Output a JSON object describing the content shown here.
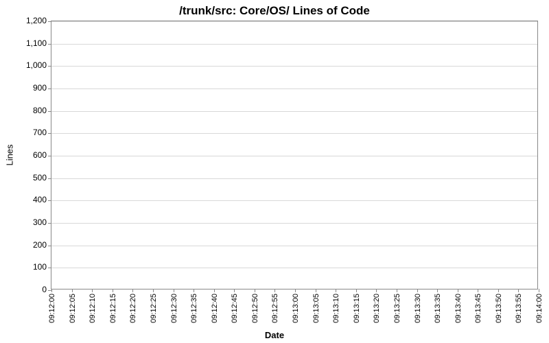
{
  "chart_data": {
    "type": "line",
    "title": "/trunk/src: Core/OS/ Lines of Code",
    "xlabel": "Date",
    "ylabel": "Lines",
    "ylim": [
      0,
      1200
    ],
    "y_ticks": [
      0,
      100,
      200,
      300,
      400,
      500,
      600,
      700,
      800,
      900,
      1000,
      1100,
      1200
    ],
    "y_tick_labels": [
      "0",
      "100",
      "200",
      "300",
      "400",
      "500",
      "600",
      "700",
      "800",
      "900",
      "1,000",
      "1,100",
      "1,200"
    ],
    "x_tick_labels": [
      "09:12:00",
      "09:12:05",
      "09:12:10",
      "09:12:15",
      "09:12:20",
      "09:12:25",
      "09:12:30",
      "09:12:35",
      "09:12:40",
      "09:12:45",
      "09:12:50",
      "09:12:55",
      "09:13:00",
      "09:13:05",
      "09:13:10",
      "09:13:15",
      "09:13:20",
      "09:13:25",
      "09:13:30",
      "09:13:35",
      "09:13:40",
      "09:13:45",
      "09:13:50",
      "09:13:55",
      "09:14:00"
    ],
    "series": [],
    "grid": true
  }
}
